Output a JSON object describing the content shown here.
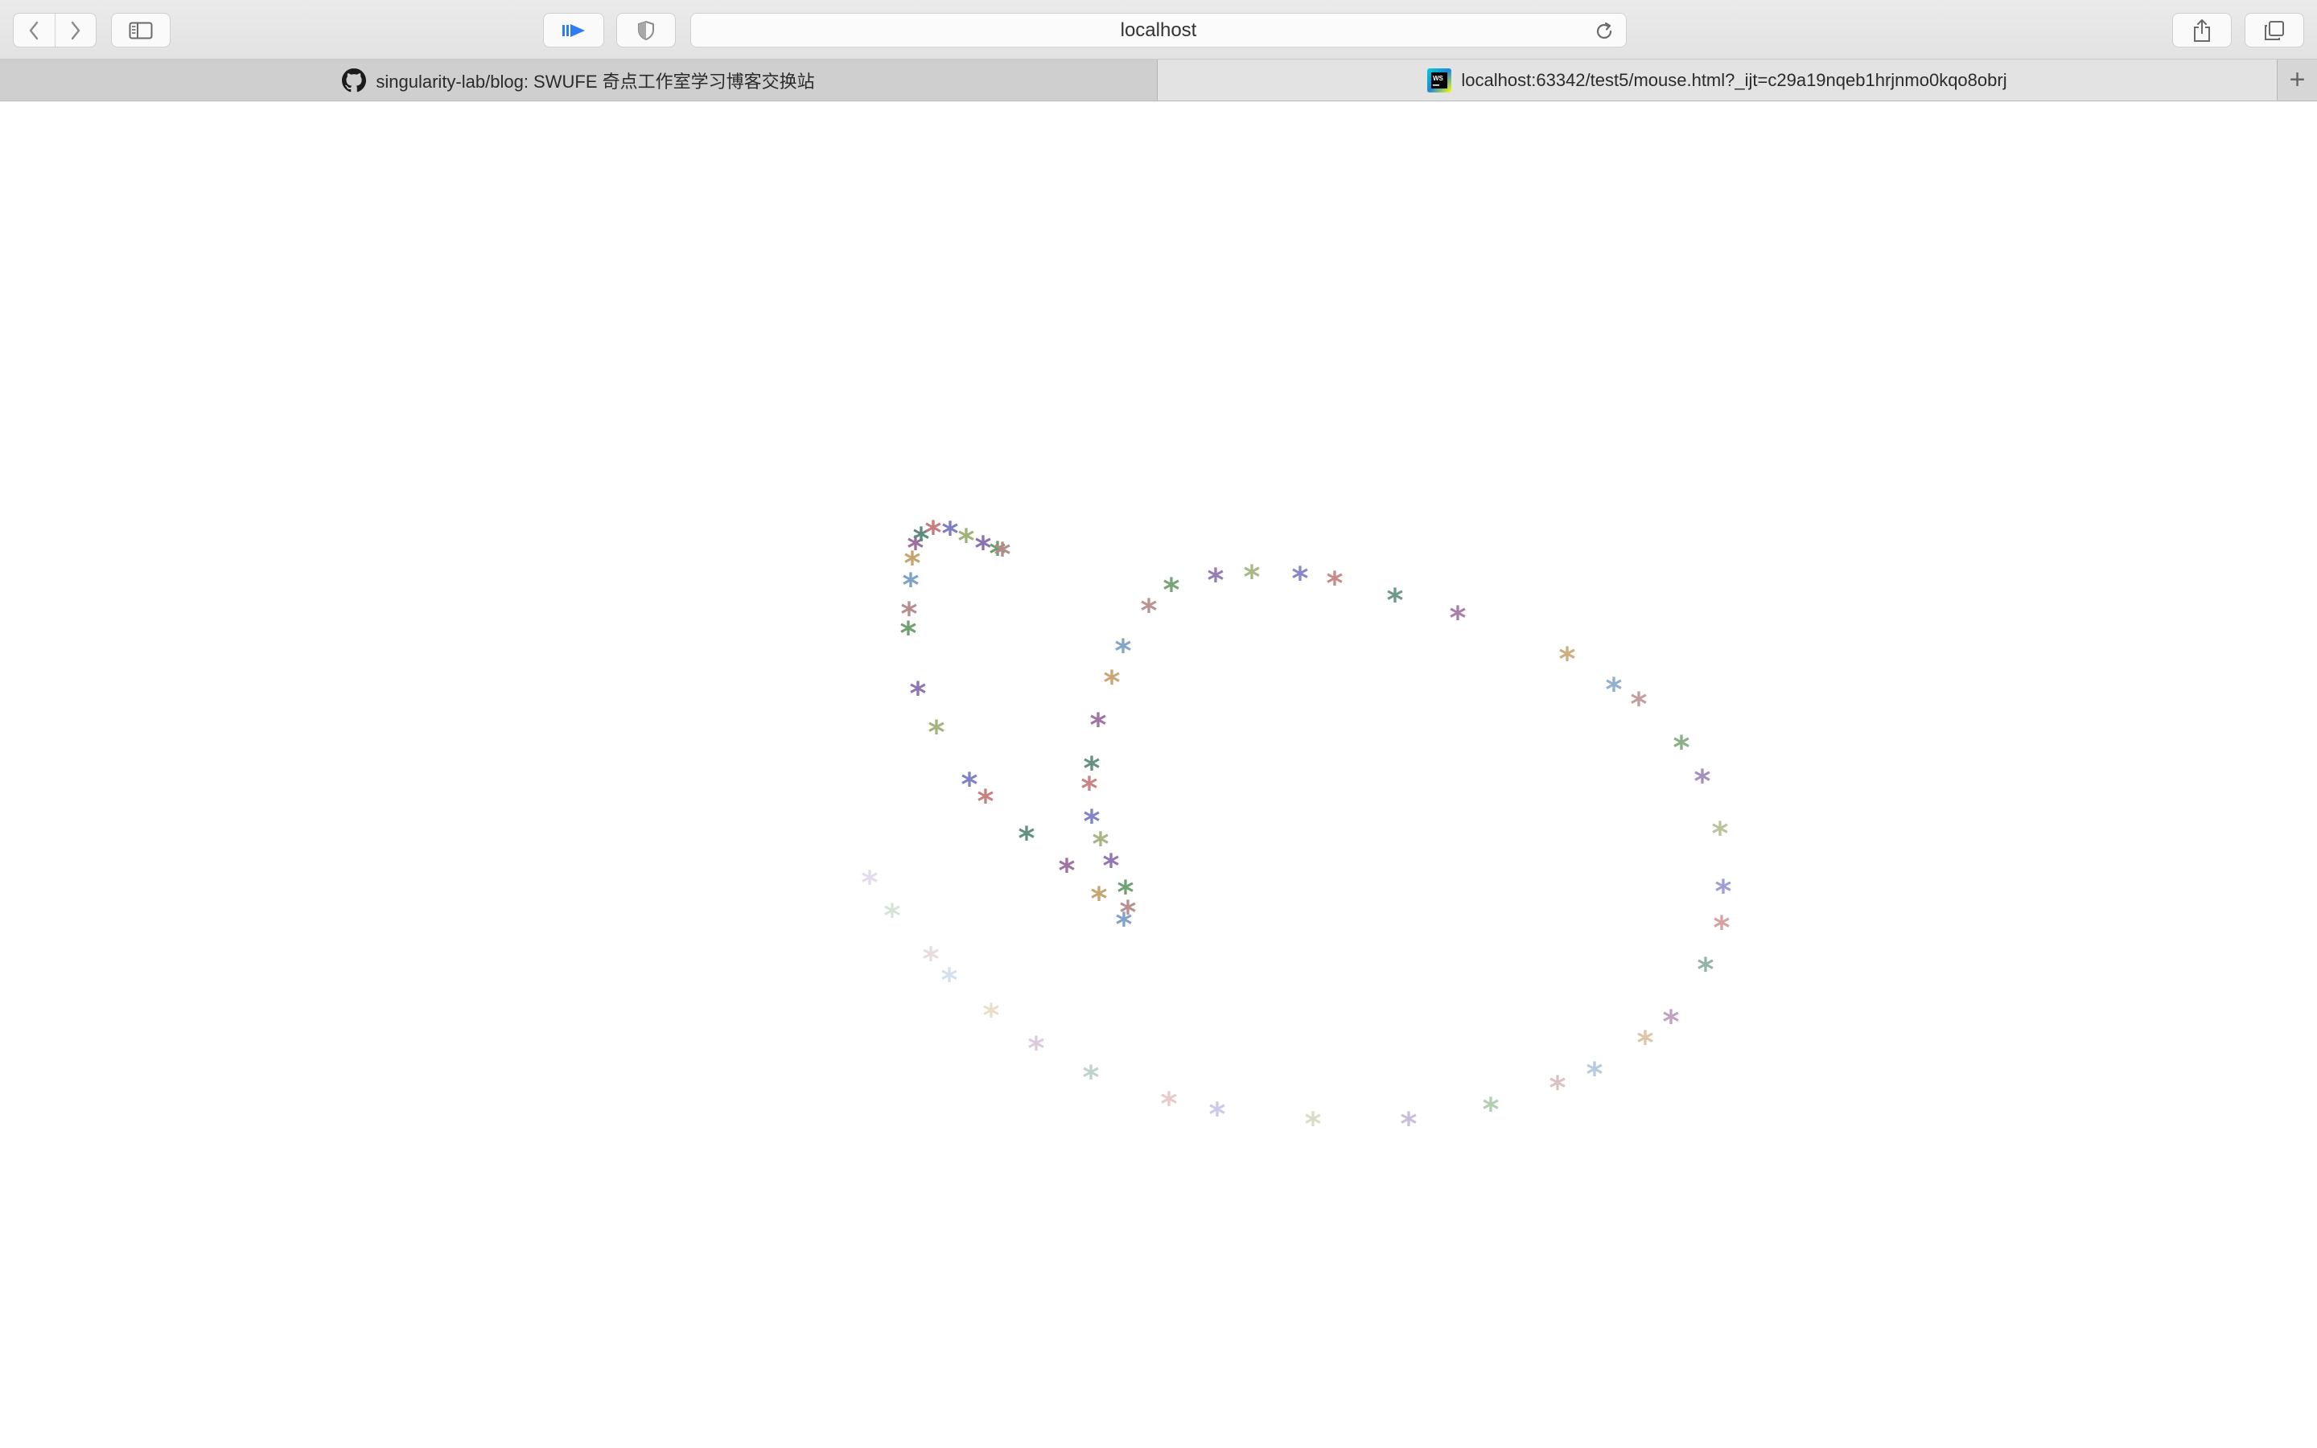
{
  "browser": {
    "address_text": "localhost",
    "icons": {
      "back": "chevron-left-icon",
      "forward": "chevron-right-icon",
      "sidebar": "sidebar-icon",
      "reader": "reader-play-icon",
      "privacy": "shield-icon",
      "reload": "reload-icon",
      "share": "share-icon",
      "tabs_overview": "tabs-overview-icon"
    },
    "accent_color": "#2f7bf6"
  },
  "tabs": [
    {
      "title": "singularity-lab/blog: SWUFE 奇点工作室学习博客交换站",
      "icon": "github-icon",
      "active": false
    },
    {
      "title": "localhost:63342/test5/mouse.html?_ijt=c29a19nqeb1hrjnmo0kqo8obrj",
      "icon": "webstorm-icon",
      "active": true
    }
  ],
  "new_tab_label": "+",
  "page": {
    "background": "#ffffff",
    "trail_glyph": "*",
    "trail_colors": [
      "#8a6fb0",
      "#6a9d6a",
      "#b48a8a",
      "#7a9ec4",
      "#c4a06a",
      "#9a6a9a",
      "#5a8a7a",
      "#c47a7a",
      "#7a7ac4",
      "#a0b07a"
    ]
  }
}
